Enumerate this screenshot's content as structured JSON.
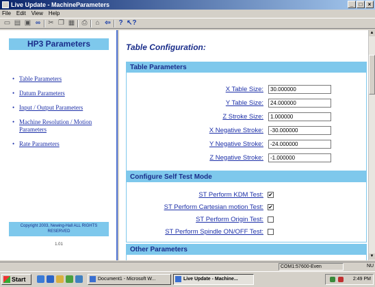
{
  "window": {
    "title": "Live Update - MachineParameters",
    "controls": [
      "_",
      "□",
      "×"
    ]
  },
  "menu": [
    "File",
    "Edit",
    "View",
    "Help"
  ],
  "toolbar_icons": [
    "new-icon",
    "open-icon",
    "save-icon",
    "binoculars-icon",
    "cut-icon",
    "copy-icon",
    "paste-icon",
    "print-icon",
    "home-icon",
    "back-icon",
    "help-icon",
    "context-help-icon"
  ],
  "sidebar": {
    "header": "HP3 Parameters",
    "items": [
      "Table Parameters",
      "Datum Parameters",
      "Input / Output Parameters",
      "Machine Resolution / Motion Parameters",
      "Rate Parameters"
    ],
    "copyright": "Copyright 2003, Newing-Hall ALL RIGHTS RESERVED",
    "version": "1.01"
  },
  "main": {
    "title": "Table Configuration:",
    "table_parameters": {
      "header": "Table Parameters",
      "fields": [
        {
          "label": "X Table Size:",
          "value": "30.000000"
        },
        {
          "label": "Y Table Size:",
          "value": "24.000000"
        },
        {
          "label": "Z Stroke Size:",
          "value": "1.000000"
        },
        {
          "label": "X Negative Stroke:",
          "value": "-30.000000"
        },
        {
          "label": "Y Negative Stroke:",
          "value": "-24.000000"
        },
        {
          "label": "Z Negative Stroke:",
          "value": "-1.000000"
        }
      ]
    },
    "self_test": {
      "header": "Configure Self Test Mode",
      "options": [
        {
          "label": "ST Perform KDM Test:",
          "checked": true
        },
        {
          "label": "ST Perform Cartesian motion Test:",
          "checked": true
        },
        {
          "label": "ST Perform Origin Test:",
          "checked": false
        },
        {
          "label": "ST Perform Spindle ON/OFF Test:",
          "checked": false
        }
      ]
    },
    "other": {
      "header": "Other Parameters"
    }
  },
  "statusbar": {
    "port": "COM1:57600-Even",
    "num": "NU"
  },
  "taskbar": {
    "start": "Start",
    "tasks": [
      "Document1 - Microsoft W...",
      "Live Update - Machine..."
    ],
    "clock": "2:49 PM"
  }
}
